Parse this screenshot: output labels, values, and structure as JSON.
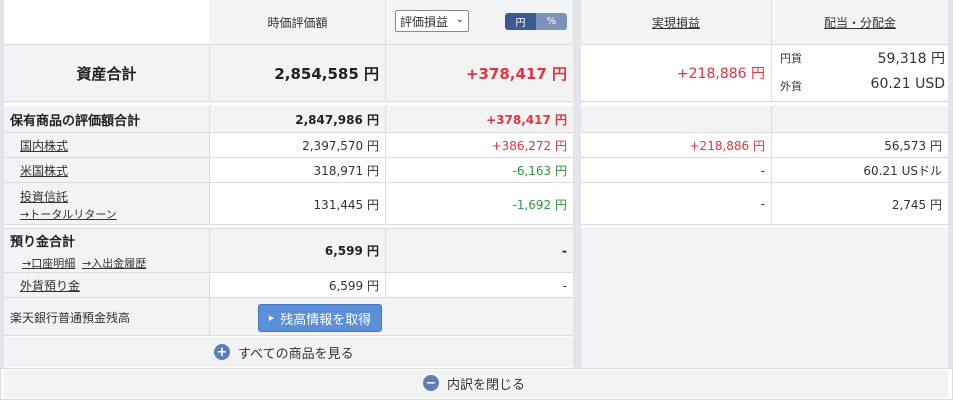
{
  "header": {
    "market_value": "時価評価額",
    "select_value": "評価損益",
    "toggle_yen": "円",
    "toggle_pct": "%",
    "realized": "実現損益",
    "dividend": "配当・分配金"
  },
  "total": {
    "label": "資産合計",
    "value": "2,854,585 円",
    "gain": "+378,417 円",
    "realized": "+218,886 円",
    "div_yen_label": "円貨",
    "div_yen_value": "59,318 円",
    "div_fx_label": "外貨",
    "div_fx_value": "60.21 USD"
  },
  "holdings": {
    "label": "保有商品の評価額合計",
    "value": "2,847,986 円",
    "gain": "+378,417 円",
    "rows": [
      {
        "name": "国内株式",
        "value": "2,397,570 円",
        "gain": "+386,272 円",
        "realized": "+218,886 円",
        "dividend": "56,573 円"
      },
      {
        "name": "米国株式",
        "value": "318,971 円",
        "gain": "-6,163 円",
        "realized": "-",
        "dividend": "60.21 USドル"
      },
      {
        "name": "投資信託",
        "sub": "→トータルリターン",
        "value": "131,445 円",
        "gain": "-1,692 円",
        "realized": "-",
        "dividend": "2,745 円"
      }
    ]
  },
  "deposit": {
    "label": "預り金合計",
    "link1": "→口座明細",
    "link2": "→入出金履歴",
    "value": "6,599 円",
    "gain": "-",
    "fx_label": "外貨預り金",
    "fx_value": "6,599 円",
    "fx_gain": "-"
  },
  "bank": {
    "label": "楽天銀行普通預金残高",
    "button": "残高情報を取得"
  },
  "footer": {
    "show_all": "すべての商品を見る",
    "close": "内訳を閉じる"
  },
  "colors": {
    "gain": "#e5333f",
    "loss": "#2c9a3a",
    "button": "#5b8fd8",
    "toggle_active": "#3b5a8f"
  }
}
